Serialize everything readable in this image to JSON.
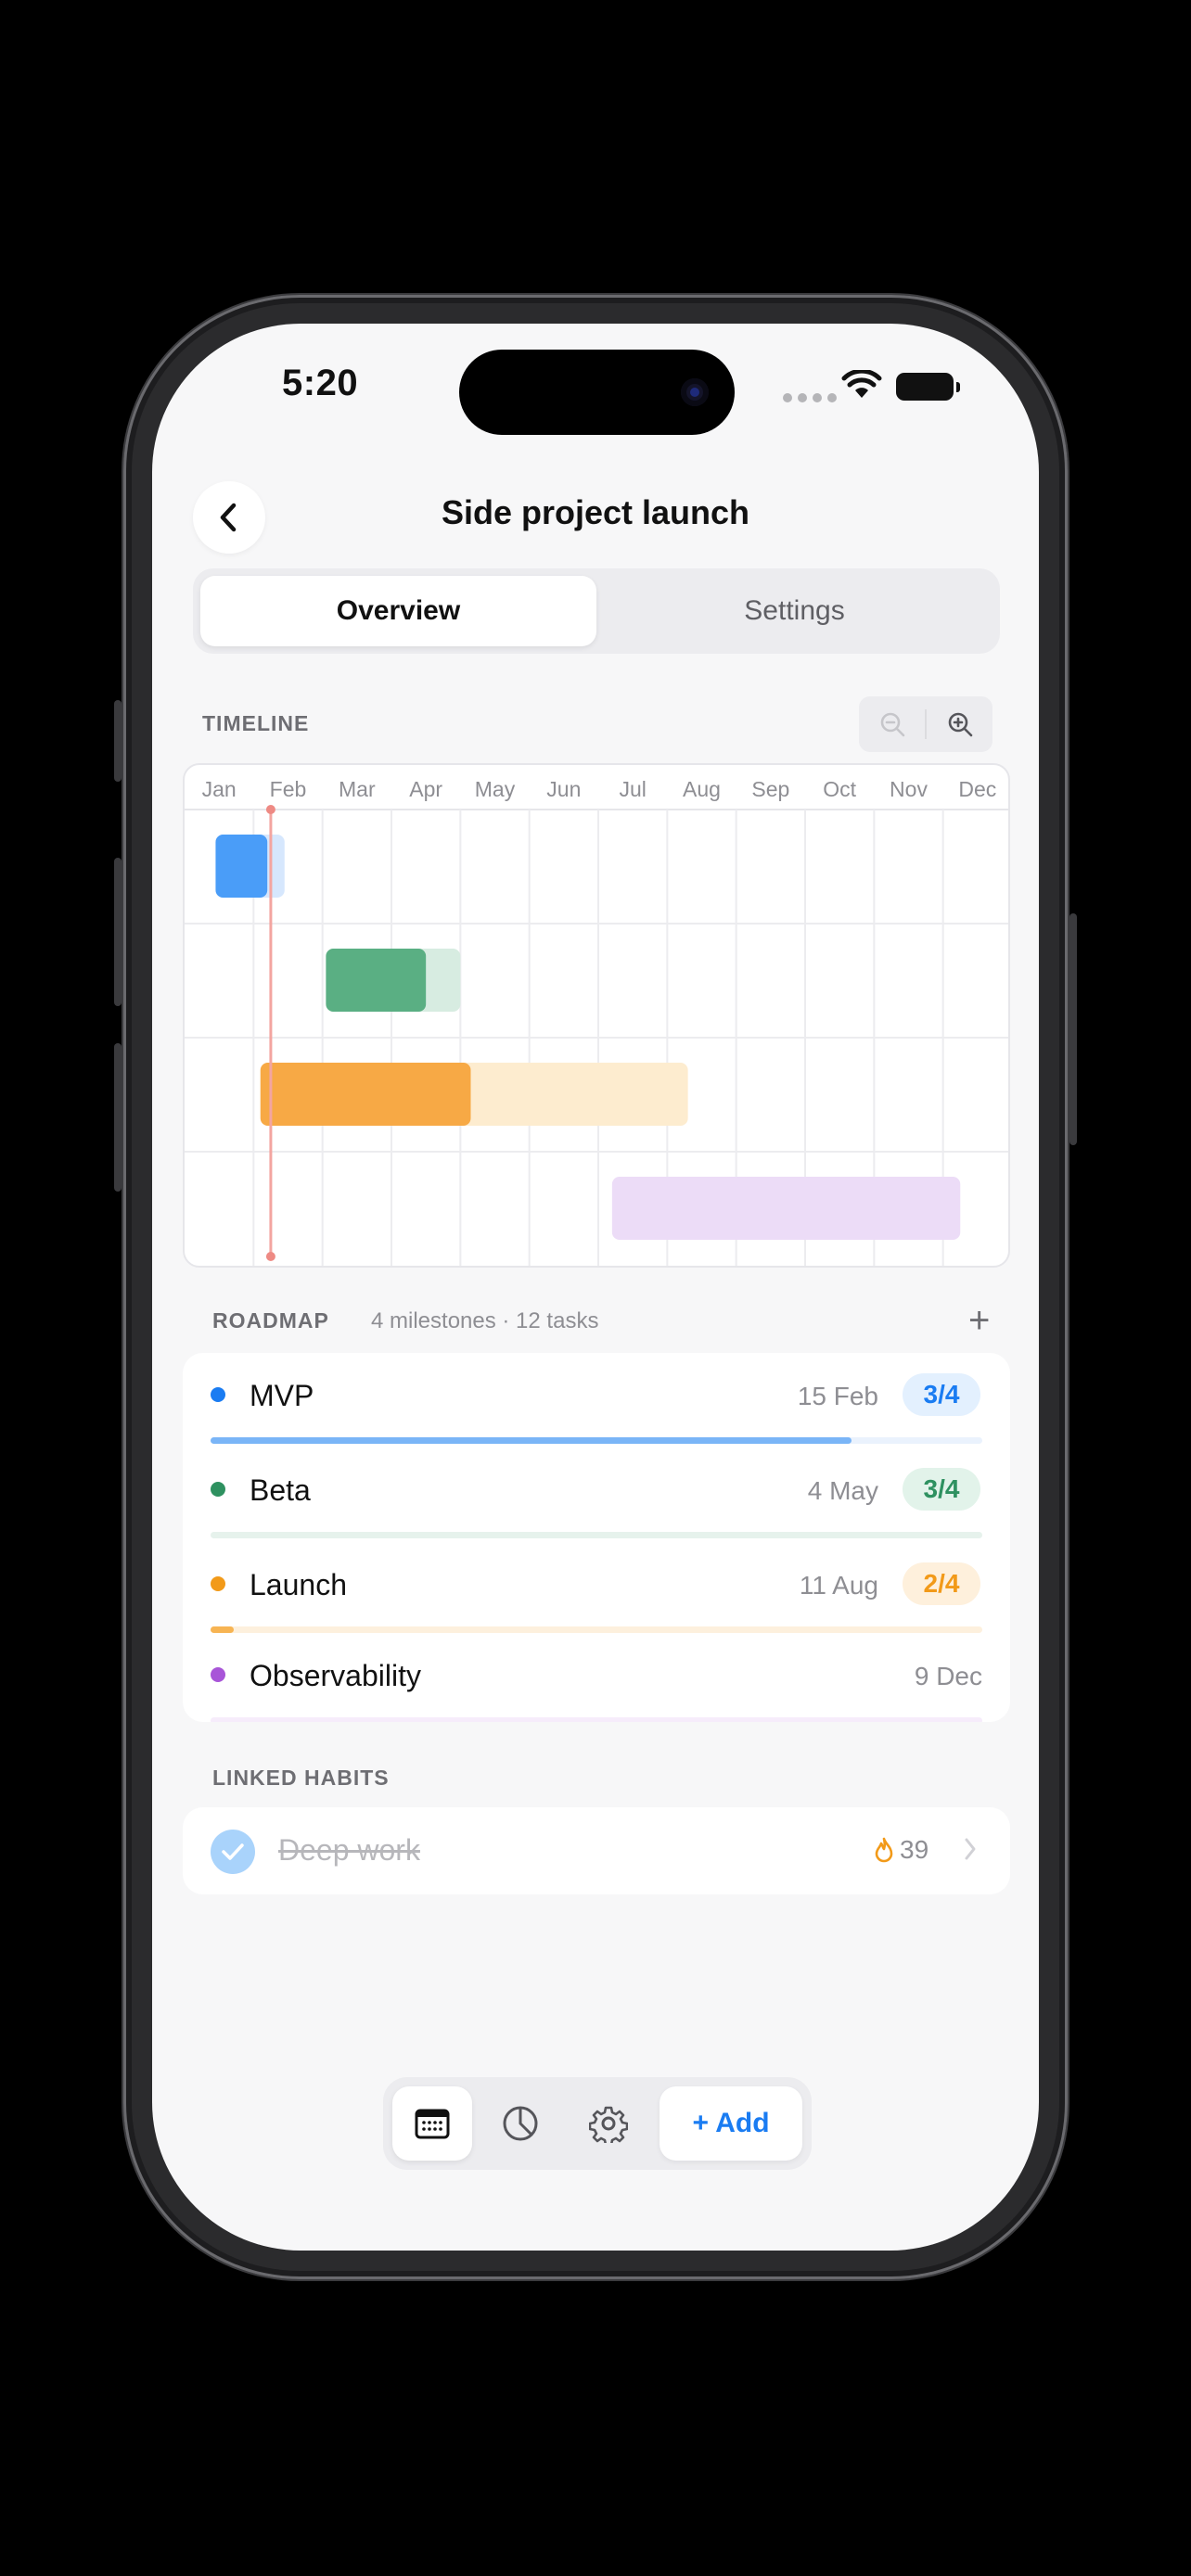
{
  "status_bar": {
    "time": "5:20"
  },
  "header": {
    "title": "Side project launch"
  },
  "tabs": [
    {
      "label": "Overview",
      "active": true
    },
    {
      "label": "Settings",
      "active": false
    }
  ],
  "timeline": {
    "label": "TIMELINE",
    "months": [
      "Jan",
      "Feb",
      "Mar",
      "Apr",
      "May",
      "Jun",
      "Jul",
      "Aug",
      "Sep",
      "Oct",
      "Nov",
      "Dec"
    ],
    "today_month": 1.25,
    "bars": [
      {
        "start_month": 0.45,
        "end_month": 1.45,
        "progress_end_month": 1.2,
        "color": "#4a9df8",
        "light_color": "#d6e7fd"
      },
      {
        "start_month": 2.05,
        "end_month": 4.0,
        "progress_end_month": 3.5,
        "color": "#5aaf83",
        "light_color": "#d7ece1"
      },
      {
        "start_month": 1.1,
        "end_month": 7.3,
        "progress_end_month": 4.15,
        "color": "#f7a945",
        "light_color": "#fdeccf"
      },
      {
        "start_month": 6.2,
        "end_month": 11.25,
        "progress_end_month": 6.2,
        "color": "#b06fdc",
        "light_color": "#ecdcf7"
      }
    ]
  },
  "roadmap": {
    "label": "ROADMAP",
    "meta": "4 milestones · 12 tasks",
    "milestones": [
      {
        "name": "MVP",
        "date": "15 Feb",
        "badge": "3/4",
        "color": "#1a7cf2",
        "badge_bg": "#e3f0fe",
        "track_bg": "#eaf2fd",
        "fill_color": "#7ab5f7",
        "progress": 0.83
      },
      {
        "name": "Beta",
        "date": "4 May",
        "badge": "3/4",
        "color": "#2e9160",
        "badge_bg": "#e2f3ea",
        "track_bg": "#e6f2ec",
        "fill_color": "#8fcdaa",
        "progress": 0
      },
      {
        "name": "Launch",
        "date": "11 Aug",
        "badge": "2/4",
        "color": "#f29a19",
        "badge_bg": "#fef0dc",
        "track_bg": "#fdf0dd",
        "fill_color": "#f7b453",
        "progress": 0.03
      },
      {
        "name": "Observability",
        "date": "9 Dec",
        "badge": "",
        "color": "#a855d8",
        "badge_bg": "",
        "track_bg": "#f6ecfb",
        "fill_color": "#d3a6ee",
        "progress": 0
      }
    ]
  },
  "habits": {
    "label": "LINKED HABITS",
    "items": [
      {
        "name": "Deep work",
        "streak": "39",
        "done": true
      }
    ]
  },
  "bottom_bar": {
    "add_label": "+ Add"
  }
}
